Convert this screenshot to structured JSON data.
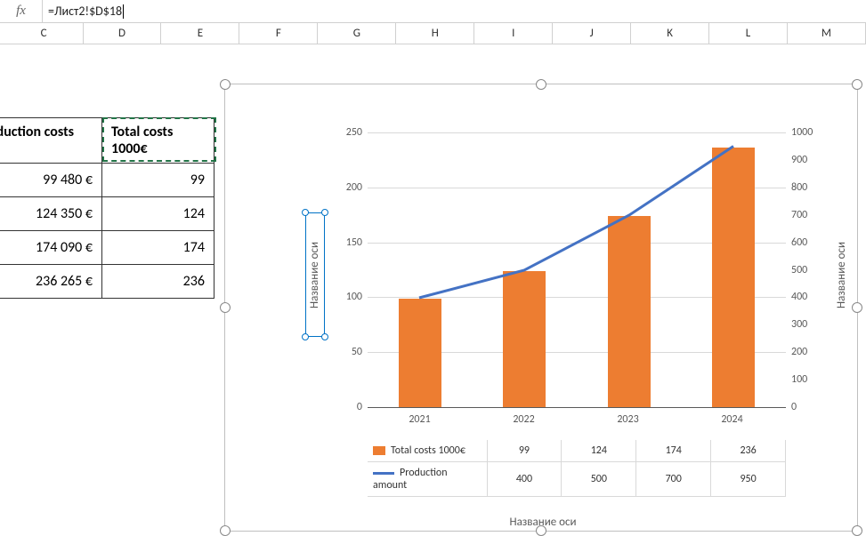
{
  "formula_bar": {
    "fx_label": "fx",
    "value": "=Лист2!$D$18"
  },
  "columns": [
    "C",
    "D",
    "E",
    "F",
    "G",
    "H",
    "I",
    "J",
    "K",
    "L",
    "M"
  ],
  "table": {
    "headers": {
      "c1": "Production costs",
      "c2": "Total costs 1000€"
    },
    "rows": [
      {
        "c1": "99 480 €",
        "c2": "99"
      },
      {
        "c1": "124 350 €",
        "c2": "124"
      },
      {
        "c1": "174 090 €",
        "c2": "174"
      },
      {
        "c1": "236 265 €",
        "c2": "236"
      }
    ]
  },
  "chart": {
    "y_left_ticks": [
      "0",
      "50",
      "100",
      "150",
      "200",
      "250"
    ],
    "y_right_ticks": [
      "0",
      "100",
      "200",
      "300",
      "400",
      "500",
      "600",
      "700",
      "800",
      "900",
      "1000"
    ],
    "y_axis_title_left": "Название оси",
    "y_axis_title_right": "Название оси",
    "x_axis_title": "Название оси",
    "categories": [
      "2021",
      "2022",
      "2023",
      "2024"
    ],
    "legend": {
      "s1": "Total costs 1000€",
      "s2": "Production amount"
    },
    "data_table": {
      "s1": [
        "99",
        "124",
        "174",
        "236"
      ],
      "s2": [
        "400",
        "500",
        "700",
        "950"
      ]
    }
  },
  "chart_data": {
    "type": "combo-bar-line",
    "categories": [
      "2021",
      "2022",
      "2023",
      "2024"
    ],
    "series": [
      {
        "name": "Total costs 1000€",
        "type": "bar",
        "axis": "left",
        "values": [
          99,
          124,
          174,
          236
        ]
      },
      {
        "name": "Production amount",
        "type": "line",
        "axis": "right",
        "values": [
          400,
          500,
          700,
          950
        ]
      }
    ],
    "ylim_left": [
      0,
      250
    ],
    "ylim_right": [
      0,
      1000
    ],
    "xlabel": "Название оси",
    "ylabel_left": "Название оси",
    "ylabel_right": "Название оси"
  }
}
